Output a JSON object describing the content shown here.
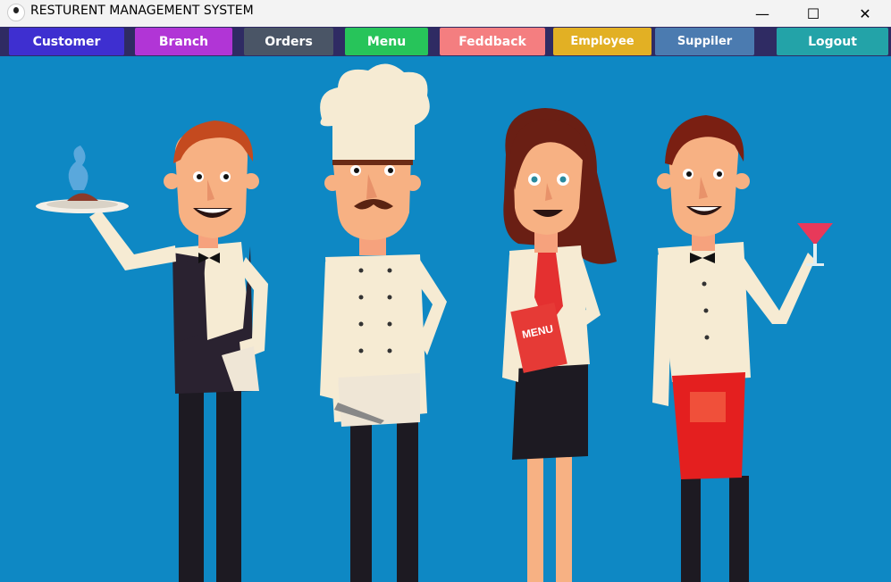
{
  "window": {
    "title": "RESTURENT MANAGEMENT SYSTEM"
  },
  "nav": [
    {
      "label": "Customer",
      "color": "#3e2fd0"
    },
    {
      "label": "Branch",
      "color": "#b135d6"
    },
    {
      "label": "Orders",
      "color": "#4a5566"
    },
    {
      "label": "Menu",
      "color": "#27c45a"
    },
    {
      "label": "Feddback",
      "color": "#f47e80"
    },
    {
      "label": "Employee",
      "color": "#e2b024"
    },
    {
      "label": "Suppiler",
      "color": "#4b7bb0"
    },
    {
      "label": "Logout",
      "color": "#23a3a8"
    }
  ],
  "illustration": {
    "menu_card_text": "MENU"
  }
}
